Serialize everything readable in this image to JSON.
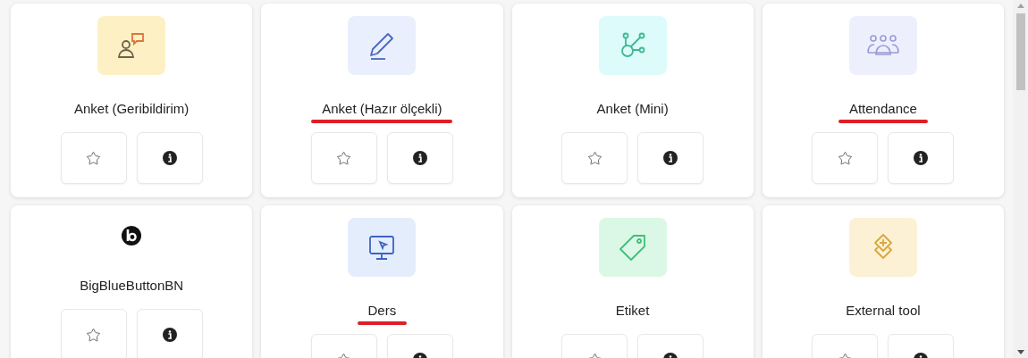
{
  "activities": [
    {
      "title": "Anket (Geribildirim)",
      "color": "#fdf0c4",
      "marked": false
    },
    {
      "title": "Anket (Hazır ölçekli)",
      "color": "#eaeffd",
      "marked": true
    },
    {
      "title": "Anket (Mini)",
      "color": "#dcfbfa",
      "marked": false
    },
    {
      "title": "Attendance",
      "color": "#eeeffc",
      "marked": true
    },
    {
      "title": "BigBlueButtonBN",
      "marked": false
    },
    {
      "title": "Ders",
      "color": "#e4edfc",
      "marked": true
    },
    {
      "title": "Etiket",
      "color": "#dbf8e7",
      "marked": false
    },
    {
      "title": "External tool",
      "color": "#fdf1d5",
      "marked": false
    }
  ]
}
